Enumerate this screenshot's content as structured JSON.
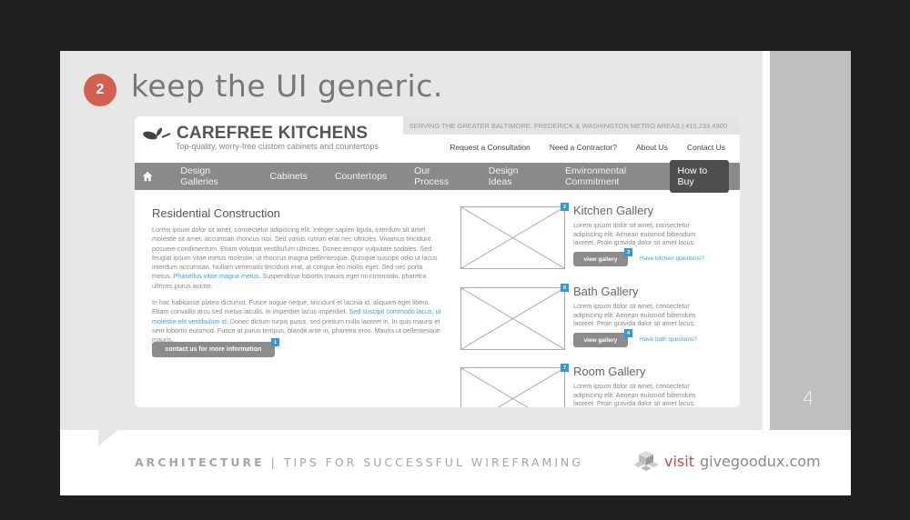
{
  "slide": {
    "step_number": "2",
    "title": "keep the UI generic.",
    "page_number": "4",
    "footer": {
      "section": "ARCHITECTURE",
      "separator": "|",
      "subtitle": "TIPS FOR SUCCESSFUL WIREFRAMING",
      "visit_label": "visit",
      "site": "givegoodux.com"
    },
    "accent": "#d2614f"
  },
  "wireframe": {
    "serving": "SERVING THE GREATER BALTIMORE, FREDERICK & WASHINGTON METRO AREAS  |  410.233.4900",
    "brand": "CAREFREE KITCHENS",
    "tagline": "Top-quality, worry-free custom cabinets and countertops",
    "utility": [
      "Request a Consultation",
      "Need a Contractor?",
      "About Us",
      "Contact Us"
    ],
    "nav": [
      "Design Galleries",
      "Cabinets",
      "Countertops",
      "Our Process",
      "Design Ideas",
      "Environmental Commitment"
    ],
    "nav_cta": "How to Buy",
    "main": {
      "heading": "Residential Construction",
      "p1a": "Lorem ipsum dolor sit amet, consectetur adipiscing elit. Integer sapien ligula, interdum sit amet molestie sit amet, accumsan rhoncus nisi. Sed varius rutrum erat nec ultricies. Vivamus tincidunt posuere condimentum. Etiam volutpat vestibulum ultricies. Donec tempor vulputate sodales. Sed feugiat ipsum vitae metus molestie, ut rhoncus magna pellentesque. Quisque suscipit odio ut lacus interdum accumsan. Nullam venenatis tincidunt erat, at congue leo mollis eget. Sed nec porta metus. ",
      "p1link": "Phasellus vitae magna metus.",
      "p1b": " Suspendisse lobortis mauris eget mi commodo, pharetra ultrices purus auctor.",
      "p2a": "In hac habitasse platea dictumst. Fusce augue neque, tincidunt et lacinia id, aliquam eget libero. Etiam convallis arcu sed metus iaculis, in imperdiet lacus imperdiet. ",
      "p2link": "Sed suscipit commodo lacus, ut molestie elit vestibulum id.",
      "p2b": " Donec dictum turpis purus, sed pretium nulla laoreet in. In quis mauris et sem lobortis euismod. Fusce at purus tempus, blandit ante in, pharetra eros. Mauris ut pellentesque mauris.",
      "contact_button": "contact us for more information",
      "contact_badge": "1"
    },
    "galleries": [
      {
        "title": "Kitchen Gallery",
        "text": "Lorem ipsum dolor sit amet, consectetur adipiscing elit. Aenean euismod bibendum laoreet. Proin gravida dolor sit amet lacus.",
        "button": "view gallery",
        "question": "Have kitchen questions?",
        "image_badge": "2",
        "button_badge": "3"
      },
      {
        "title": "Bath Gallery",
        "text": "Lorem ipsum dolor sit amet, consectetur adipiscing elit. Aenean euismod bibendum laoreet. Proin gravida dolor sit amet lacus.",
        "button": "view gallery",
        "question": "Have bath questions?",
        "image_badge": "6",
        "button_badge": "4"
      },
      {
        "title": "Room Gallery",
        "text": "Lorem ipsum dolor sit amet, consectetur adipiscing elit. Aenean euismod bibendum laoreet. Proin gravida dolor sit amet lacus.",
        "image_badge": "7"
      }
    ],
    "link_color": "#3aa3d6",
    "badge_color": "#2f9ad6"
  }
}
